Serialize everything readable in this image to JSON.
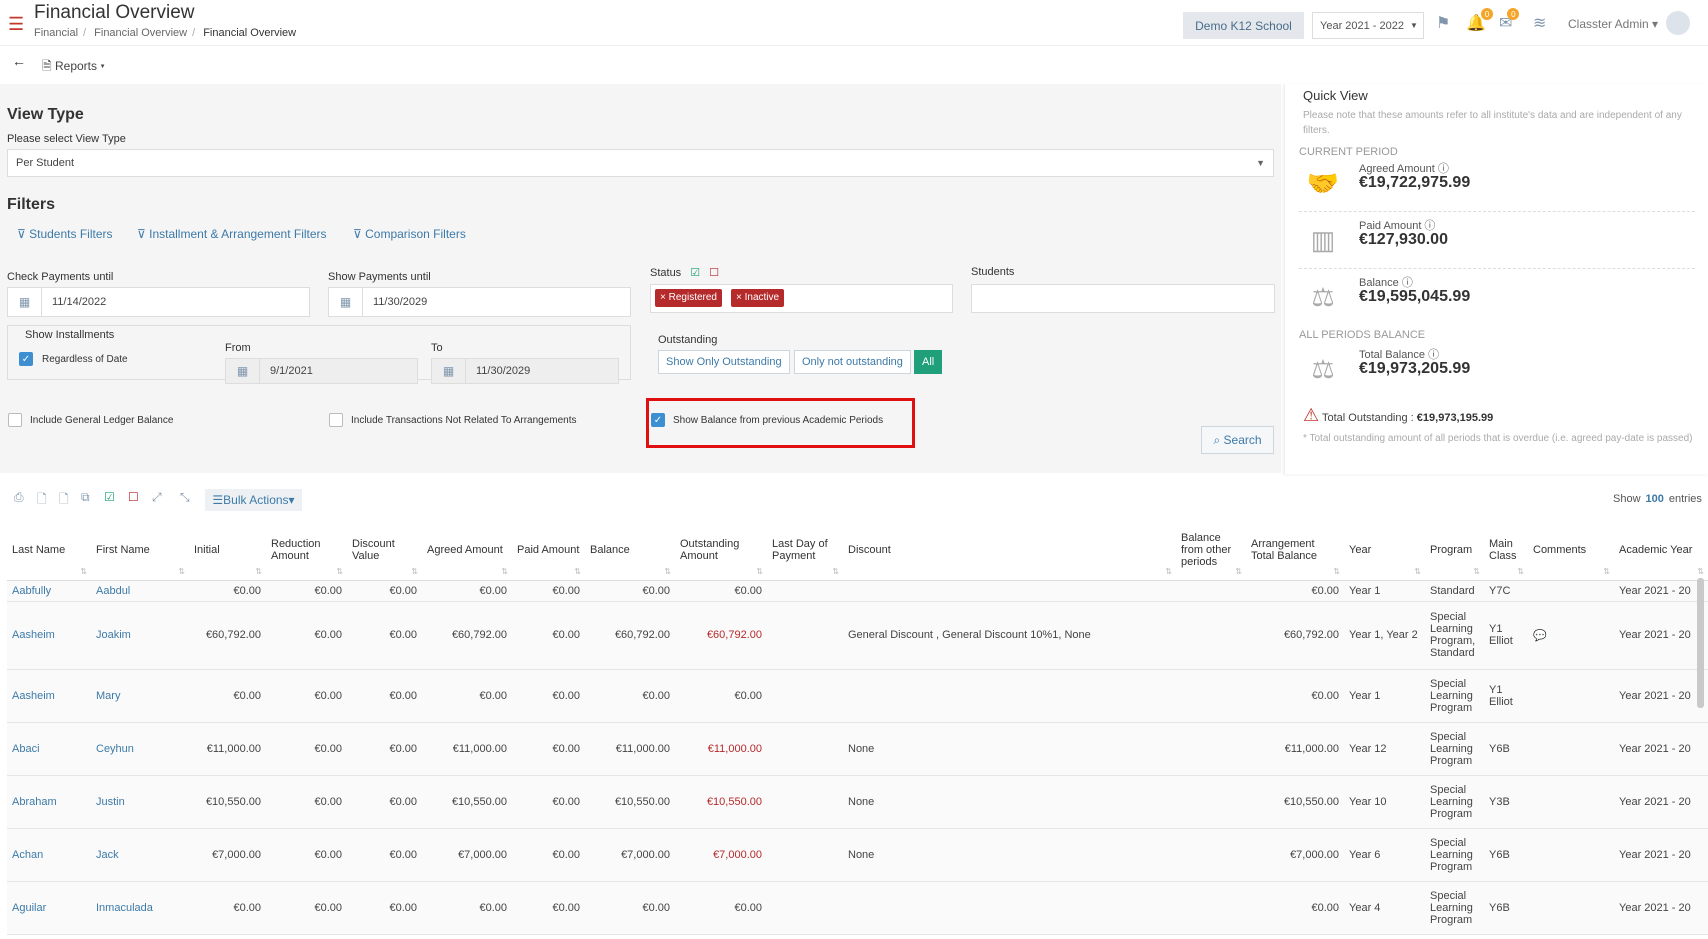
{
  "header": {
    "title": "Financial Overview",
    "breadcrumb": [
      "Financial",
      "Financial Overview",
      "Financial Overview"
    ],
    "school": "Demo K12 School",
    "year": "Year 2021 - 2022",
    "bell_count": "0",
    "mail_count": "0",
    "user": "Classter Admin"
  },
  "subbar": {
    "reports": "Reports"
  },
  "view_type": {
    "heading": "View Type",
    "label": "Please select View Type",
    "value": "Per Student"
  },
  "filters": {
    "heading": "Filters",
    "links": [
      "Students Filters",
      "Installment & Arrangement Filters",
      "Comparison Filters"
    ],
    "check_payments_label": "Check Payments until",
    "check_payments_value": "11/14/2022",
    "show_payments_label": "Show Payments until",
    "show_payments_value": "11/30/2029",
    "status_label": "Status",
    "status_tags": [
      "Registered",
      "Inactive"
    ],
    "students_label": "Students",
    "show_installments_label": "Show Installments",
    "regardless_label": "Regardless of Date",
    "from_label": "From",
    "from_value": "9/1/2021",
    "to_label": "To",
    "to_value": "11/30/2029",
    "outstanding_label": "Outstanding",
    "outstanding_options": [
      "Show Only Outstanding",
      "Only not outstanding",
      "All"
    ],
    "gl_balance_label": "Include General Ledger Balance",
    "not_related_label": "Include Transactions Not Related To Arrangements",
    "prev_periods_label": "Show Balance from previous Academic Periods",
    "search_label": "Search"
  },
  "quick_view": {
    "title": "Quick View",
    "note": "Please note that these amounts refer to all institute's data and are independent of any filters.",
    "current_period": "CURRENT PERIOD",
    "all_periods": "ALL PERIODS BALANCE",
    "agreed_label": "Agreed Amount",
    "agreed_value": "€19,722,975.99",
    "paid_label": "Paid Amount",
    "paid_value": "€127,930.00",
    "balance_label": "Balance",
    "balance_value": "€19,595,045.99",
    "total_balance_label": "Total Balance",
    "total_balance_value": "€19,973,205.99",
    "total_outstanding_label": "Total Outstanding :",
    "total_outstanding_value": "€19,973,195.99",
    "footnote": "* Total outstanding amount of all periods that is overdue (i.e. agreed pay-date is passed)"
  },
  "table_tools": {
    "bulk": "Bulk Actions",
    "show": "Show",
    "show_count": "100",
    "entries": "entries"
  },
  "table": {
    "columns": [
      "Last Name",
      "First Name",
      "Initial",
      "Reduction Amount",
      "Discount Value",
      "Agreed Amount",
      "Paid Amount",
      "Balance",
      "Outstanding Amount",
      "Last Day of Payment",
      "Discount",
      "Balance from other periods",
      "Arrangement Total Balance",
      "Year",
      "Program",
      "Main Class",
      "Comments",
      "Academic Year"
    ],
    "rows": [
      [
        "Aabfully",
        "Aabdul",
        "€0.00",
        "€0.00",
        "€0.00",
        "€0.00",
        "€0.00",
        "€0.00",
        "€0.00",
        "",
        "",
        "",
        "€0.00",
        "Year 1",
        "Standard",
        "Y7C",
        "",
        "Year 2021 - 20"
      ],
      [
        "Aasheim",
        "Joakim",
        "€60,792.00",
        "€0.00",
        "€0.00",
        "€60,792.00",
        "€0.00",
        "€60,792.00",
        "€60,792.00",
        "",
        "General Discount , General Discount 10%1, None",
        "",
        "€60,792.00",
        "Year 1, Year 2",
        "Special Learning Program, Standard",
        "Y1 Elliot",
        "💬",
        "Year 2021 - 20"
      ],
      [
        "Aasheim",
        "Mary",
        "€0.00",
        "€0.00",
        "€0.00",
        "€0.00",
        "€0.00",
        "€0.00",
        "€0.00",
        "",
        "",
        "",
        "€0.00",
        "Year 1",
        "Special Learning Program",
        "Y1 Elliot",
        "",
        "Year 2021 - 20"
      ],
      [
        "Abaci",
        "Ceyhun",
        "€11,000.00",
        "€0.00",
        "€0.00",
        "€11,000.00",
        "€0.00",
        "€11,000.00",
        "€11,000.00",
        "",
        "None",
        "",
        "€11,000.00",
        "Year 12",
        "Special Learning Program",
        "Y6B",
        "",
        "Year 2021 - 20"
      ],
      [
        "Abraham",
        "Justin",
        "€10,550.00",
        "€0.00",
        "€0.00",
        "€10,550.00",
        "€0.00",
        "€10,550.00",
        "€10,550.00",
        "",
        "None",
        "",
        "€10,550.00",
        "Year 10",
        "Special Learning Program",
        "Y3B",
        "",
        "Year 2021 - 20"
      ],
      [
        "Achan",
        "Jack",
        "€7,000.00",
        "€0.00",
        "€0.00",
        "€7,000.00",
        "€0.00",
        "€7,000.00",
        "€7,000.00",
        "",
        "None",
        "",
        "€7,000.00",
        "Year 6",
        "Special Learning Program",
        "Y6B",
        "",
        "Year 2021 - 20"
      ],
      [
        "Aguilar",
        "Inmaculada",
        "€0.00",
        "€0.00",
        "€0.00",
        "€0.00",
        "€0.00",
        "€0.00",
        "€0.00",
        "",
        "",
        "",
        "€0.00",
        "Year 4",
        "Special Learning Program",
        "Y6B",
        "",
        "Year 2021 - 20"
      ]
    ]
  }
}
